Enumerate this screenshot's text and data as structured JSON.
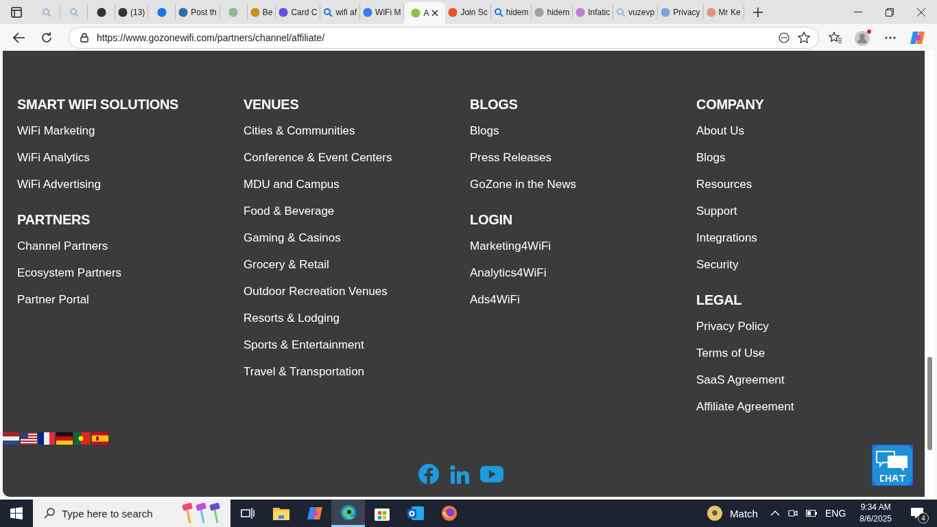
{
  "browser": {
    "tabs": [
      {
        "kind": "search",
        "color": "#9bb8d8",
        "selected": false
      },
      {
        "kind": "search",
        "color": "#9bb8d8",
        "selected": false
      },
      {
        "kind": "favicon",
        "color": "#333333",
        "selected": false
      },
      {
        "kind": "favicon",
        "color": "#333333",
        "label": "(13)",
        "selected": false
      },
      {
        "kind": "favicon",
        "color": "#1a73e8",
        "selected": false
      },
      {
        "kind": "favicon",
        "color": "#2f6fa7",
        "label": "Post th",
        "selected": false
      },
      {
        "kind": "favicon",
        "color": "#8fb98f",
        "selected": false
      },
      {
        "kind": "favicon",
        "color": "#c8901c",
        "label": "Be",
        "selected": false
      },
      {
        "kind": "favicon",
        "color": "#6a4ee0",
        "label": "Card C",
        "selected": false
      },
      {
        "kind": "search",
        "color": "#1a73e8",
        "label": "wifi af",
        "selected": false
      },
      {
        "kind": "favicon",
        "color": "#3a7de8",
        "label": "WiFi M",
        "selected": false
      },
      {
        "kind": "favicon",
        "color": "#8cc63f",
        "label": "A",
        "selected": true
      },
      {
        "kind": "favicon",
        "color": "#e8552a",
        "label": "Join Sc",
        "selected": false
      },
      {
        "kind": "search",
        "color": "#1a73e8",
        "label": "hidem",
        "selected": false
      },
      {
        "kind": "favicon",
        "color": "#a0a0a0",
        "label": "hidem",
        "selected": false
      },
      {
        "kind": "favicon",
        "color": "#c07fd0",
        "label": "Infatic",
        "selected": false
      },
      {
        "kind": "search",
        "color": "#9bb8d8",
        "label": "vuzevp",
        "selected": false
      },
      {
        "kind": "favicon",
        "color": "#7fa3d8",
        "label": "Privacy",
        "selected": false
      },
      {
        "kind": "favicon",
        "color": "#e0977a",
        "label": "Mr Ke",
        "selected": false
      }
    ],
    "address": "https://www.gozonewifi.com/partners/channel/affiliate/"
  },
  "footer": {
    "columns": [
      {
        "sections": [
          {
            "heading": "SMART WIFI SOLUTIONS",
            "links": [
              "WiFi Marketing",
              "WiFi Analytics",
              "WiFi Advertising"
            ]
          },
          {
            "heading": "PARTNERS",
            "links": [
              "Channel Partners",
              "Ecosystem Partners",
              "Partner Portal"
            ]
          }
        ]
      },
      {
        "sections": [
          {
            "heading": "VENUES",
            "links": [
              "Cities & Communities",
              "Conference & Event Centers",
              "MDU and Campus",
              "Food & Beverage",
              "Gaming & Casinos",
              "Grocery & Retail",
              "Outdoor Recreation Venues",
              "Resorts & Lodging",
              "Sports & Entertainment",
              "Travel & Transportation"
            ]
          }
        ]
      },
      {
        "sections": [
          {
            "heading": "BLOGS",
            "links": [
              "Blogs",
              "Press Releases",
              "GoZone in the News"
            ]
          },
          {
            "heading": "LOGIN",
            "links": [
              "Marketing4WiFi",
              "Analytics4WiFi",
              "Ads4WiFi"
            ]
          }
        ]
      },
      {
        "sections": [
          {
            "heading": "COMPANY",
            "links": [
              "About Us",
              "Blogs",
              "Resources",
              "Support",
              "Integrations",
              "Security"
            ]
          },
          {
            "heading": "LEGAL",
            "links": [
              "Privacy Policy",
              "Terms of Use",
              "SaaS Agreement",
              "Affiliate Agreement"
            ]
          }
        ]
      }
    ]
  },
  "taskbar": {
    "search_placeholder": "Type here to search",
    "apps": [
      {
        "kind": "taskview",
        "selected": false
      },
      {
        "kind": "folder",
        "selected": false
      },
      {
        "kind": "copilot",
        "selected": false
      },
      {
        "kind": "edge",
        "selected": true
      },
      {
        "kind": "store",
        "selected": false
      },
      {
        "kind": "outlook",
        "selected": false
      },
      {
        "kind": "firefox",
        "selected": false
      }
    ],
    "weather": "Match",
    "language": "ENG",
    "time": "9:34 AM",
    "date": "8/6/2025",
    "notifications": "4"
  }
}
